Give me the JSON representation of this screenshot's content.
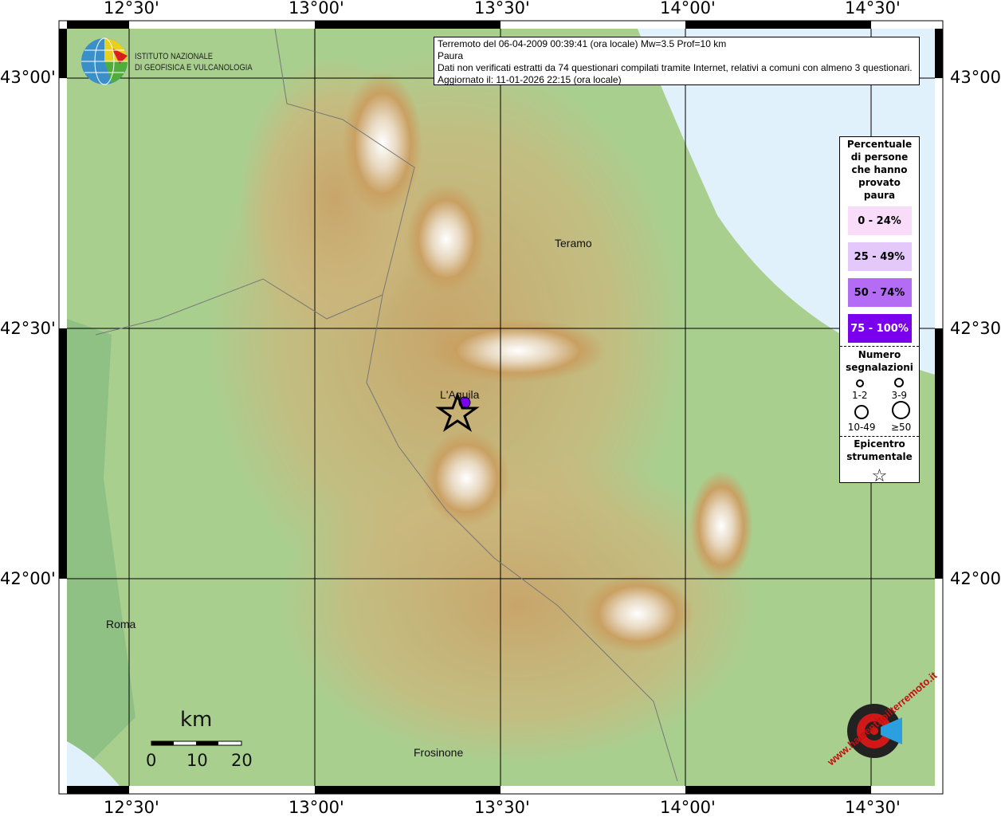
{
  "info": {
    "line1": "Terremoto del 06-04-2009 00:39:41 (ora locale) Mw=3.5 Prof=10 km",
    "line2": "Paura",
    "line3": "Dati non verificati estratti da 74 questionari compilati tramite Internet, relativi a comuni con almeno 3 questionari.",
    "line4": "Aggiornato il: 11-01-2026 22:15 (ora locale)"
  },
  "axes": {
    "lon_ticks": [
      "12°30'",
      "13°00'",
      "13°30'",
      "14°00'",
      "14°30'"
    ],
    "lat_ticks": [
      "43°00'",
      "42°30'",
      "42°00'"
    ]
  },
  "logo": {
    "line1": "ISTITUTO NAZIONALE",
    "line2": "DI GEOFISICA E VULCANOLOGIA"
  },
  "places": {
    "teramo": "Teramo",
    "laquila": "L'Aquila",
    "roma": "Roma",
    "frosinone": "Frosinone"
  },
  "legend": {
    "title": [
      "Percentuale",
      "di persone",
      "che hanno",
      "provato",
      "paura"
    ],
    "classes": [
      {
        "label": "0 - 24%",
        "color": "#f9dcf9",
        "text": "#000"
      },
      {
        "label": "25 - 49%",
        "color": "#e4c8f9",
        "text": "#000"
      },
      {
        "label": "50 - 74%",
        "color": "#b46cf5",
        "text": "#000"
      },
      {
        "label": "75 - 100%",
        "color": "#7a00ee",
        "text": "#fff"
      }
    ],
    "count_title": [
      "Numero",
      "segnalazioni"
    ],
    "counts": [
      "1-2",
      "3-9",
      "10-49",
      "≥50"
    ],
    "epi_title": [
      "Epicentro",
      "strumentale"
    ],
    "epi_icon": "star-outline-icon"
  },
  "scale": {
    "unit": "km",
    "labels": [
      "0",
      "10",
      "20"
    ]
  },
  "watermark": "www.haisentitoilterremoto.it",
  "colors": {
    "sea": "#e1f1fc",
    "lowland": "#9fc98a",
    "hills": "#c9a86a",
    "peaks": "#ffffff",
    "point": "#7a00ee"
  }
}
